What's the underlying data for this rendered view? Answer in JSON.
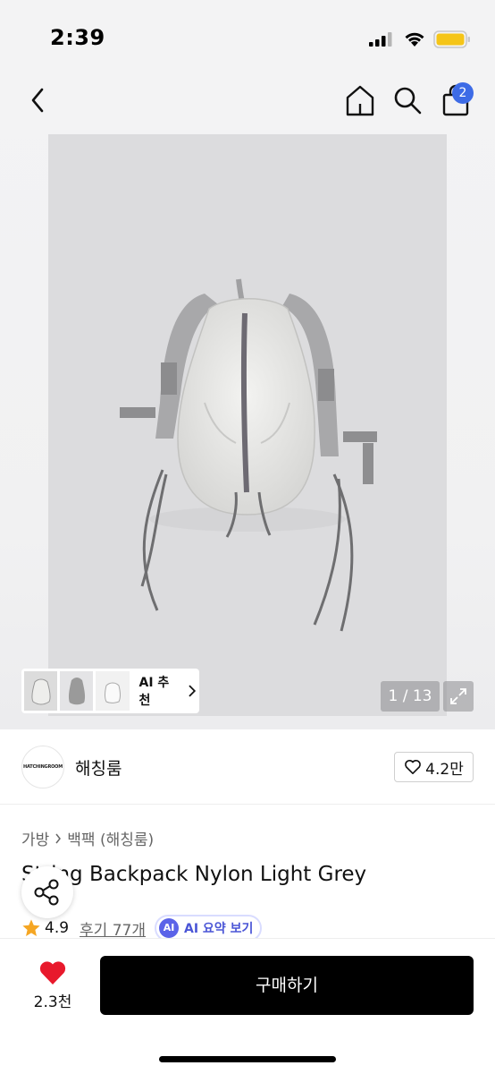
{
  "status_bar": {
    "time": "2:39"
  },
  "header": {
    "back_icon": "chevron-left-icon",
    "home_icon": "home-icon",
    "search_icon": "search-icon",
    "cart_icon": "shopping-bag-icon",
    "cart_count": "2"
  },
  "gallery": {
    "thumbnails": [
      "thumb-1",
      "thumb-2",
      "thumb-3"
    ],
    "ai_recommend_label": "AI 추천",
    "pager": "1 / 13",
    "expand_icon": "expand-icon"
  },
  "brand": {
    "logo_text": "HATCHINGROOM",
    "name": "해칭룸",
    "like_count": "4.2만"
  },
  "breadcrumb": [
    "가방",
    "백팩 (해칭룸)"
  ],
  "product": {
    "title": "String Backpack Nylon Light Grey",
    "rating": "4.9",
    "reviews_label": "후기 77개",
    "ai_badge": "AI",
    "ai_summary_label": "AI 요약 보기"
  },
  "bottom_bar": {
    "heart_count": "2.3천",
    "buy_label": "구매하기"
  },
  "colors": {
    "accent_blue": "#3d6be6",
    "ai_purple": "#5b63e8",
    "heart_red": "#e8192c",
    "star_orange": "#f5a623"
  }
}
